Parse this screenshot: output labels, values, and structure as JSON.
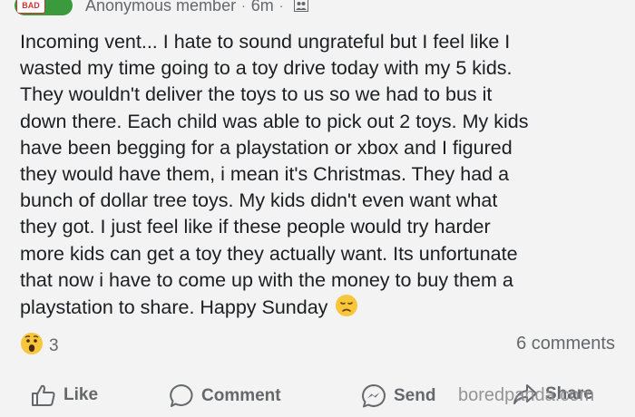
{
  "header": {
    "badge_text": "BAD",
    "author": "Anonymous member",
    "separator": "·",
    "time": "6m",
    "separator2": "·",
    "audience_icon": "members-icon"
  },
  "post": {
    "text": "Incoming vent... I hate to sound ungrateful but I feel like I\nwasted my time going to a toy drive today with my 5 kids.\nThey wouldn't deliver the toys to us so we had to bus it\ndown there. Each child was able to pick out 2 toys. My kids\nhave been begging for a playstation or xbox and I figured\nthey would have them, i mean it's Christmas. They had a\nbunch of dollar tree toys. My kids didn't even want what\nthey got. I just feel like if these people would try harder\nmore kids can get a toy they actually want. Its unfortunate\nthat now i have to come up with the money to buy them a\nplaystation to share. Happy Sunday",
    "emoji": "disappointed-face"
  },
  "stats": {
    "reaction_emoji": "wow-face",
    "reaction_count": "3",
    "comments": "6 comments"
  },
  "actions": {
    "like": "Like",
    "comment": "Comment",
    "send": "Send",
    "share": "Share"
  },
  "watermark": "boredpanda.com",
  "colors": {
    "background": "#f3f3f3",
    "text": "#1c1e21",
    "muted": "#65676b",
    "badge_green": "#3b9a3b"
  }
}
